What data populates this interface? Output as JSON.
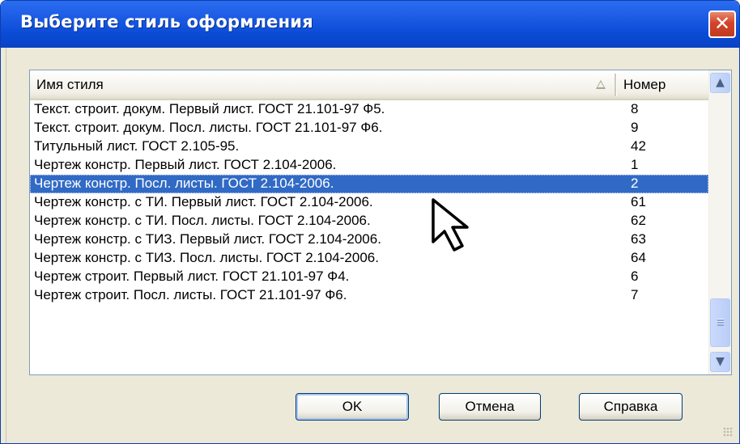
{
  "window": {
    "title": "Выберите стиль оформления",
    "close_glyph": "✕"
  },
  "list": {
    "columns": {
      "name": "Имя стиля",
      "number": "Номер"
    },
    "sort_icon": "sort-ascending-icon",
    "rows": [
      {
        "name": "Текст. строит. докум. Первый лист. ГОСТ 21.101-97 Ф5.",
        "number": "8"
      },
      {
        "name": "Текст. строит. докум. Посл. листы. ГОСТ 21.101-97 Ф6.",
        "number": "9"
      },
      {
        "name": "Титульный лист. ГОСТ 2.105-95.",
        "number": "42"
      },
      {
        "name": "Чертеж констр. Первый лист. ГОСТ 2.104-2006.",
        "number": "1"
      },
      {
        "name": "Чертеж констр. Посл. листы. ГОСТ 2.104-2006.",
        "number": "2"
      },
      {
        "name": "Чертеж констр. с ТИ. Первый лист. ГОСТ 2.104-2006.",
        "number": "61"
      },
      {
        "name": "Чертеж констр. с ТИ. Посл. листы. ГОСТ 2.104-2006.",
        "number": "62"
      },
      {
        "name": "Чертеж констр. с ТИЗ. Первый лист. ГОСТ 2.104-2006.",
        "number": "63"
      },
      {
        "name": "Чертеж констр. с ТИЗ. Посл. листы. ГОСТ 2.104-2006.",
        "number": "64"
      },
      {
        "name": "Чертеж строит. Первый лист. ГОСТ 21.101-97 Ф4.",
        "number": "6"
      },
      {
        "name": "Чертеж строит. Посл. листы.  ГОСТ 21.101-97 Ф6.",
        "number": "7"
      }
    ],
    "selected_index": 4
  },
  "scrollbar": {
    "up_glyph": "▲",
    "down_glyph": "▼"
  },
  "buttons": {
    "ok": "OK",
    "cancel": "Отмена",
    "help": "Справка"
  },
  "colors": {
    "title_bar": "#0a4bd6",
    "selection": "#316ac5",
    "dialog_bg": "#ece9d8"
  }
}
